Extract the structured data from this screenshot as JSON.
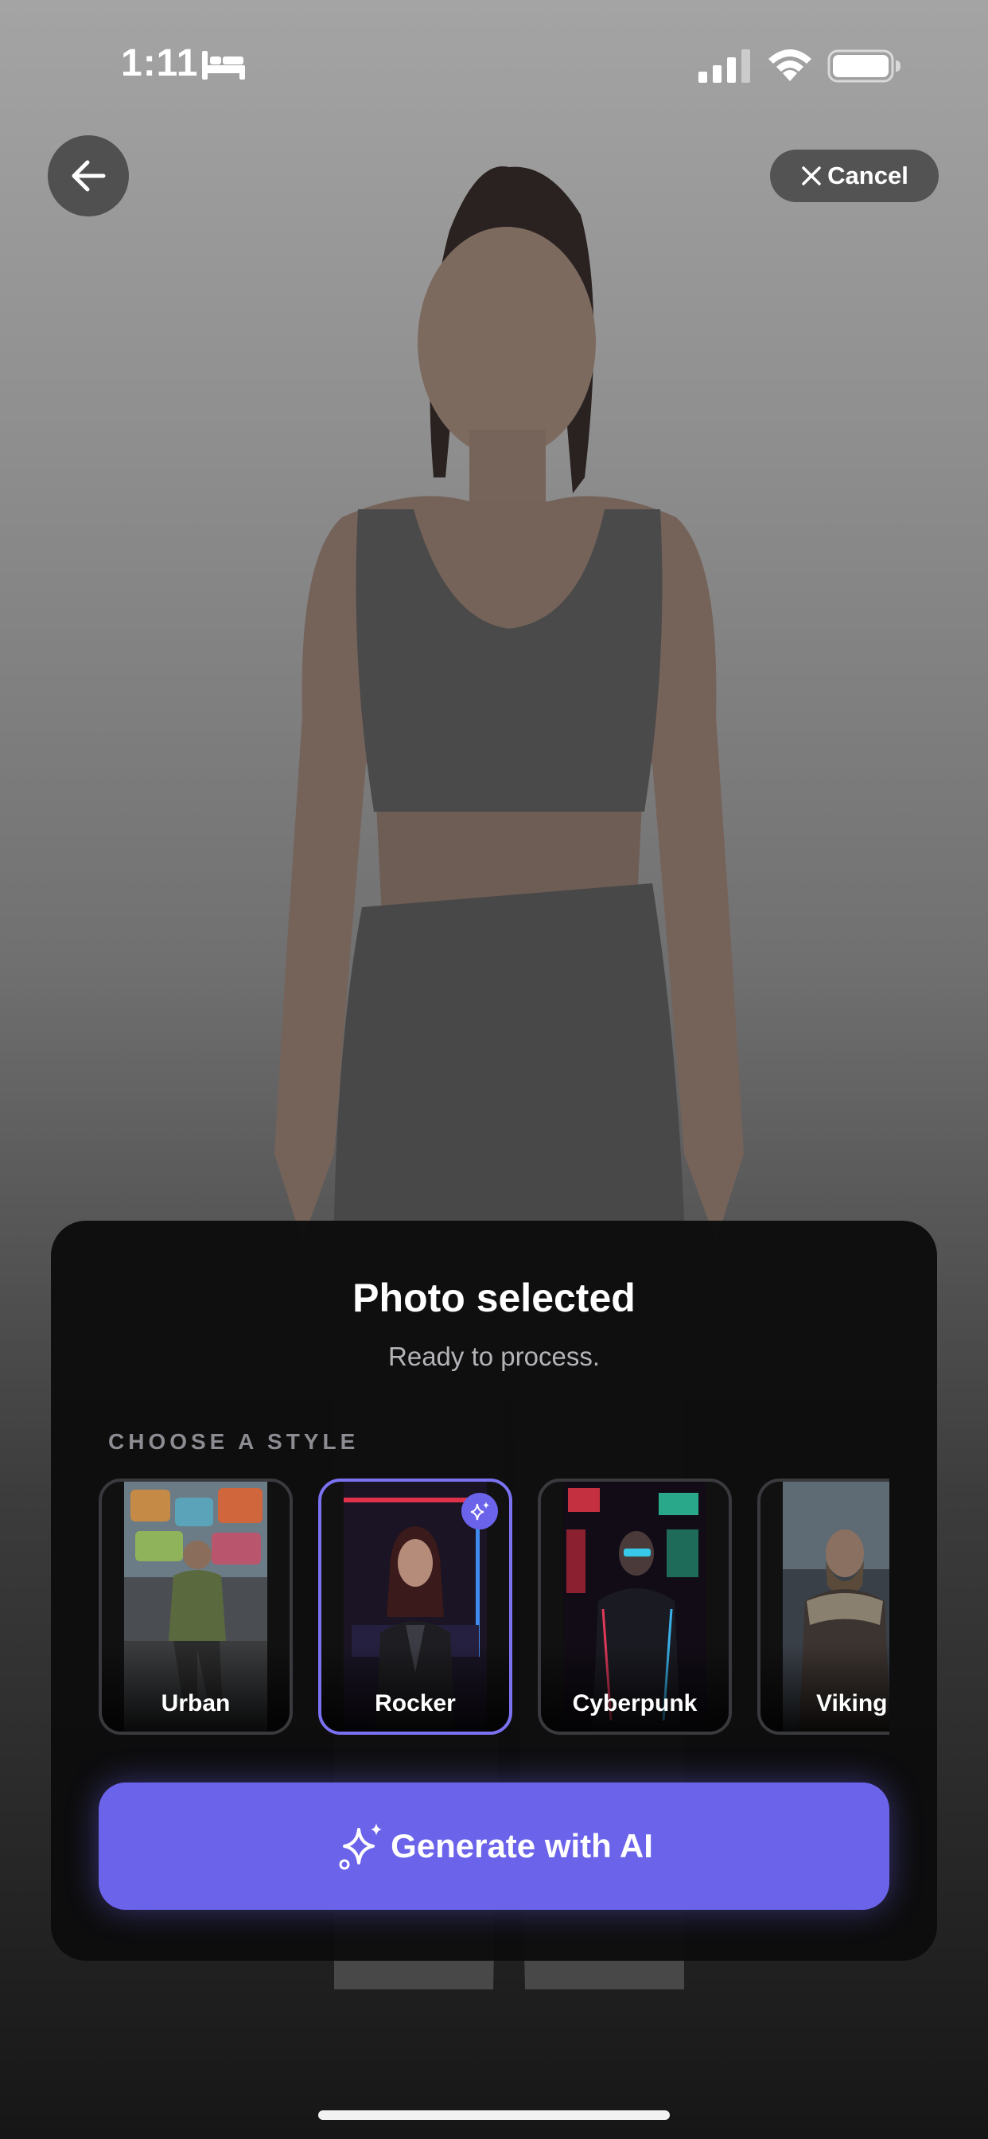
{
  "status_bar": {
    "time": "1:11",
    "focus_icon": "bed-icon",
    "signal_icon": "cellular-signal-icon",
    "wifi_icon": "wifi-icon",
    "battery_icon": "battery-icon"
  },
  "header": {
    "back_icon": "arrow-left-icon",
    "cancel_label": "Cancel",
    "cancel_icon": "close-icon"
  },
  "sheet": {
    "title": "Photo selected",
    "subtitle": "Ready to process.",
    "section_label": "CHOOSE A STYLE",
    "styles": [
      {
        "label": "Urban",
        "selected": false
      },
      {
        "label": "Rocker",
        "selected": true
      },
      {
        "label": "Cyberpunk",
        "selected": false
      },
      {
        "label": "Viking",
        "selected": false
      }
    ],
    "generate_label": "Generate with AI",
    "generate_icon": "sparkles-icon"
  },
  "colors": {
    "accent": "#6b63ea",
    "selected_border": "#7b72f2",
    "sheet_background": "#0c0c0e"
  }
}
